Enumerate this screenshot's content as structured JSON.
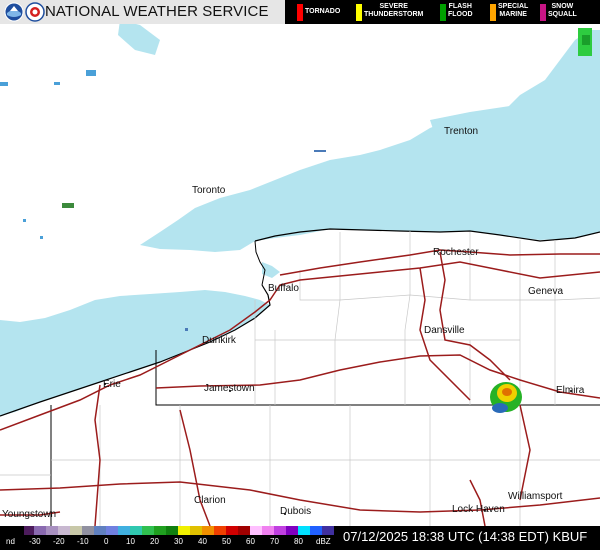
{
  "header": {
    "title": "NATIONAL WEATHER SERVICE",
    "logos": [
      "noaa-logo",
      "nws-logo"
    ],
    "warnings": [
      {
        "label_lines": [
          "TORNADO"
        ],
        "color": "#ff0000"
      },
      {
        "label_lines": [
          "SEVERE",
          "THUNDERSTORM"
        ],
        "color": "#ffff00"
      },
      {
        "label_lines": [
          "FLASH",
          "FLOOD"
        ],
        "color": "#00a000"
      },
      {
        "label_lines": [
          "SPECIAL",
          "MARINE"
        ],
        "color": "#ffa500"
      },
      {
        "label_lines": [
          "SNOW",
          "SQUALL"
        ],
        "color": "#c71585"
      }
    ]
  },
  "map": {
    "water_color": "#b4e4ef",
    "land_color": "#ffffff",
    "road_color": "#9b1c1c",
    "cities": [
      {
        "id": "trenton",
        "name": "Trenton"
      },
      {
        "id": "toronto",
        "name": "Toronto"
      },
      {
        "id": "rochester",
        "name": "Rochester"
      },
      {
        "id": "geneva",
        "name": "Geneva"
      },
      {
        "id": "buffalo",
        "name": "Buffalo"
      },
      {
        "id": "dansville",
        "name": "Dansville"
      },
      {
        "id": "dunkirk",
        "name": "Dunkirk"
      },
      {
        "id": "erie",
        "name": "Erie"
      },
      {
        "id": "jamestown",
        "name": "Jamestown"
      },
      {
        "id": "elmira",
        "name": "Elmira"
      },
      {
        "id": "clarion",
        "name": "Clarion"
      },
      {
        "id": "dubois",
        "name": "Dubois"
      },
      {
        "id": "williamsport",
        "name": "Williamsport"
      },
      {
        "id": "youngstown",
        "name": "Youngstown"
      },
      {
        "id": "lock-haven",
        "name": "Lock Haven"
      }
    ]
  },
  "footer": {
    "scale_labels": [
      "nd",
      "-30",
      "-20",
      "-10",
      "0",
      "10",
      "20",
      "30",
      "40",
      "50",
      "60",
      "70",
      "80",
      "dBZ"
    ],
    "timestamp": "07/12/2025 18:38 UTC (14:38 EDT)",
    "station": "KBUF"
  }
}
